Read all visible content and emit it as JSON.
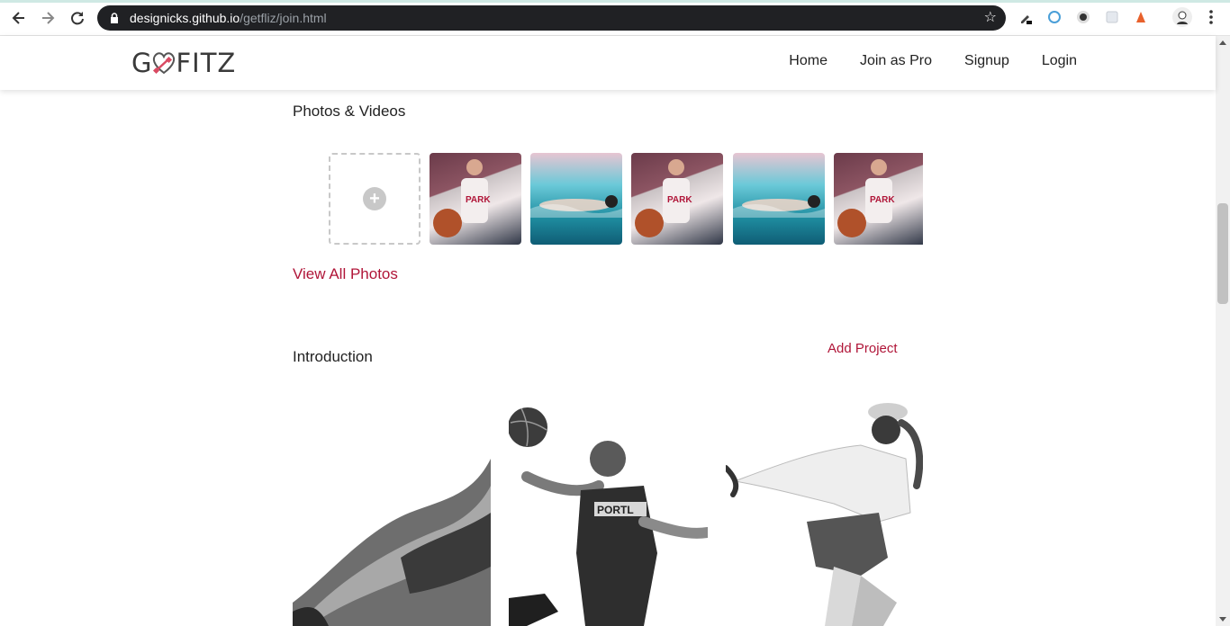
{
  "browser": {
    "url_host": "designicks.github.io",
    "url_path": "/getfliz/join.html",
    "icons": [
      "back-icon",
      "forward-icon",
      "reload-icon",
      "lock-icon",
      "star-icon",
      "eyedropper-icon",
      "sync-icon",
      "dark-mode-icon",
      "extension-icon",
      "extension-alert-icon",
      "profile-avatar",
      "kebab-menu-icon"
    ]
  },
  "site": {
    "logo_left": "G",
    "logo_right": "FITZ",
    "menu": [
      "Home",
      "Join as Pro",
      "Signup",
      "Login"
    ]
  },
  "photos": {
    "title": "Photos & Videos",
    "view_all": "View All Photos",
    "thumbnails": [
      "basketball",
      "swimming",
      "basketball",
      "swimming",
      "basketball"
    ]
  },
  "intro": {
    "title": "Introduction",
    "add_project": "Add Project"
  },
  "colors": {
    "accent": "#b01538",
    "omnibox": "#202124"
  }
}
